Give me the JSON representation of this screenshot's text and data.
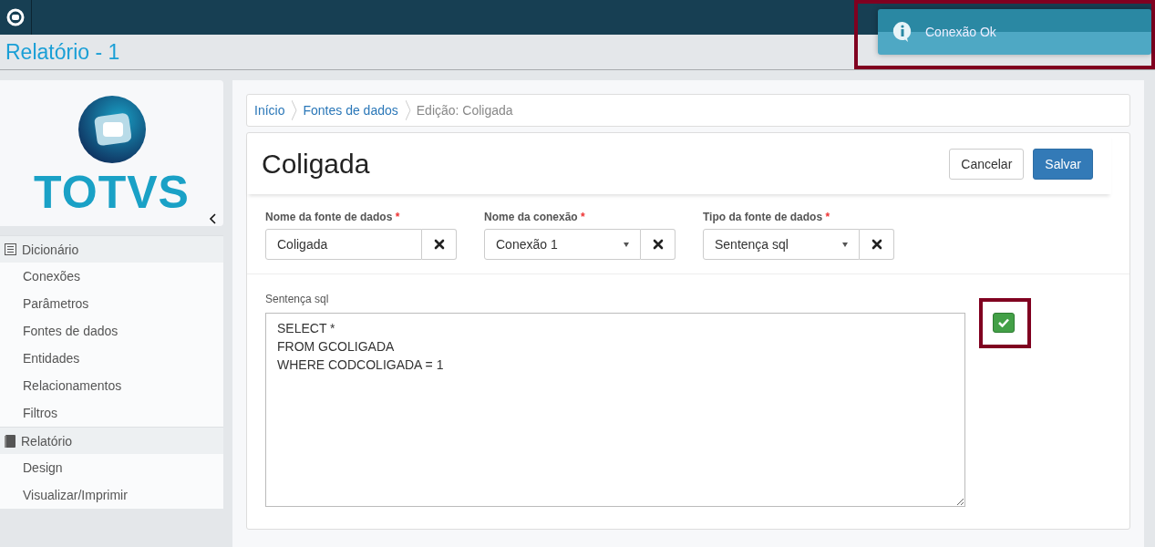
{
  "app": {
    "title": "Relatório - 1"
  },
  "toast": {
    "message": "Conexão Ok"
  },
  "sidebar": {
    "logo_text": "TOTVS",
    "sections": [
      {
        "label": "Dicionário",
        "kind": "list",
        "items": [
          "Conexões",
          "Parâmetros",
          "Fontes de dados",
          "Entidades",
          "Relacionamentos",
          "Filtros"
        ]
      },
      {
        "label": "Relatório",
        "kind": "book",
        "items": [
          "Design",
          "Visualizar/Imprimir"
        ]
      }
    ]
  },
  "breadcrumb": [
    {
      "label": "Início",
      "kind": "link"
    },
    {
      "label": "Fontes de dados",
      "kind": "link"
    },
    {
      "label": "Edição: Coligada",
      "kind": "current"
    }
  ],
  "form": {
    "title": "Coligada",
    "buttons": [
      {
        "label": "Cancelar",
        "kind": "default"
      },
      {
        "label": "Salvar",
        "kind": "primary"
      }
    ],
    "fields": [
      {
        "label": "Nome da fonte de dados",
        "required_mark": "*",
        "kind": "text",
        "value": "Coligada"
      },
      {
        "label": "Nome da conexão",
        "required_mark": "*",
        "kind": "select",
        "value": "Conexão 1"
      },
      {
        "label": "Tipo da fonte de dados",
        "required_mark": "*",
        "kind": "select",
        "value": "Sentença sql"
      }
    ],
    "sql": {
      "label": "Sentença sql",
      "value": "SELECT *\nFROM GCOLIGADA\nWHERE CODCOLIGADA = 1"
    }
  }
}
